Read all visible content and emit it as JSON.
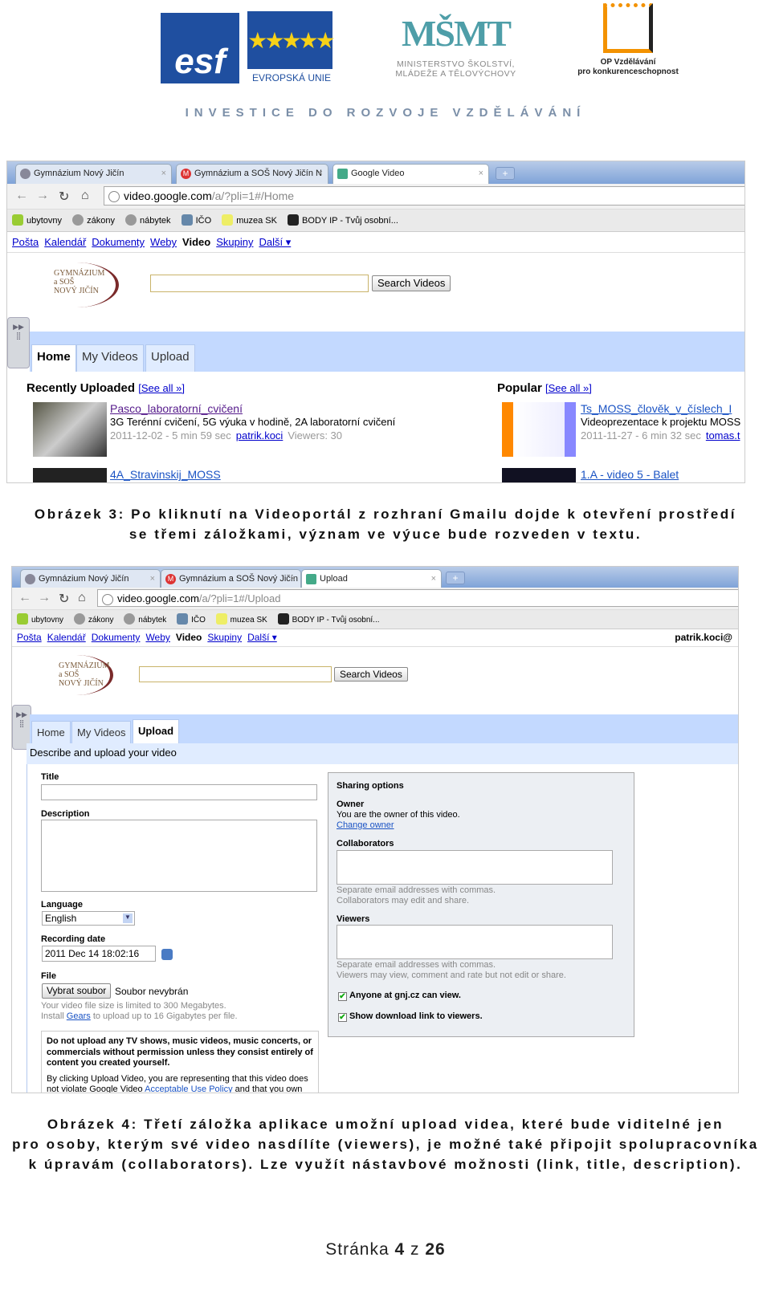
{
  "header": {
    "esf_logo": "esf",
    "eu_label": "EVROPSKÁ UNIE",
    "msmt_logo": "MŠMT",
    "msmt_label_1": "MINISTERSTVO ŠKOLSTVÍ,",
    "msmt_label_2": "MLÁDEŽE A TĚLOVÝCHOVY",
    "op_label_1": "OP Vzdělávání",
    "op_label_2": "pro konkurenceschopnost",
    "tagline": "INVESTICE DO ROZVOJE VZDĚLÁVÁNÍ"
  },
  "browser": {
    "tabs": [
      "Gymnázium Nový Jičín",
      "Gymnázium a SOŠ Nový Jičín N",
      "Google Video"
    ],
    "tabs2": [
      "Gymnázium Nový Jičín",
      "Gymnázium a SOŠ Nový Jičín N",
      "Upload"
    ],
    "url_host": "video.google.com",
    "url_path_home": "/a/?pli=1#/Home",
    "url_path_upload": "/a/?pli=1#/Upload",
    "bookmarks": [
      "ubytovny",
      "zákony",
      "nábytek",
      "IČO",
      "muzea SK",
      "BODY IP - Tvůj osobní..."
    ],
    "gnav": [
      "Pošta",
      "Kalendář",
      "Dokumenty",
      "Weby",
      "Video",
      "Skupiny",
      "Další ▾"
    ],
    "user": "patrik.koci@"
  },
  "video_app": {
    "school_logo_1": "GYMNÁZIUM",
    "school_logo_2": "a SOŠ",
    "school_logo_3": "NOVÝ JIČÍN",
    "search_button": "Search Videos",
    "tabs": [
      "Home",
      "My Videos",
      "Upload"
    ],
    "recent": {
      "heading": "Recently Uploaded",
      "see_all": "[See all »]",
      "items": [
        {
          "title": "Pasco_laboratorní_cvičení",
          "desc": "3G Terénní cvičení, 5G výuka v hodině, 2A laboratorní cvičení",
          "meta": "2011-12-02 - 5 min 59 sec",
          "author": "patrik.koci",
          "viewers": "Viewers: 30"
        },
        {
          "title": "4A_Stravinskij_MOSS"
        }
      ]
    },
    "popular": {
      "heading": "Popular",
      "see_all": "[See all »]",
      "items": [
        {
          "title": "Ts_MOSS_člověk_v_číslech_I",
          "desc": "Videoprezentace k projektu MOSS",
          "meta": "2011-11-27 - 6 min 32 sec",
          "author": "tomas.t"
        },
        {
          "title": "1.A - video 5 - Balet"
        }
      ]
    }
  },
  "upload": {
    "subheader": "Describe and upload your video",
    "title_label": "Title",
    "description_label": "Description",
    "language_label": "Language",
    "language_value": "English",
    "recording_date_label": "Recording date",
    "recording_date_value": "2011 Dec 14 18:02:16",
    "file_label": "File",
    "file_button": "Vybrat soubor",
    "file_status": "Soubor nevybrán",
    "size_note": "Your video file size is limited to 300 Megabytes.",
    "gears_pre": "Install ",
    "gears_link": "Gears",
    "gears_post": " to upload up to 16 Gigabytes per file.",
    "warning_1": "Do not upload any TV shows, music videos, music concerts, or commercials without permission unless they consist entirely of content you created yourself.",
    "warning_2_pre": "By clicking Upload Video, you are representing that this video does not violate Google Video ",
    "warning_2_link": "Acceptable Use Policy",
    "warning_2_post": " and that you own",
    "sharing": {
      "heading": "Sharing options",
      "owner_label": "Owner",
      "owner_text": "You are the owner of this video.",
      "change_owner": "Change owner",
      "collaborators_label": "Collaborators",
      "collab_note_1": "Separate email addresses with commas.",
      "collab_note_2": "Collaborators may edit and share.",
      "viewers_label": "Viewers",
      "viewers_note_1": "Separate email addresses with commas.",
      "viewers_note_2": "Viewers may view, comment and rate but not edit or share.",
      "anyone_checkbox": "Anyone at gnj.cz can view.",
      "anyone_checked": true,
      "download_checkbox": "Show download link to viewers.",
      "download_checked": true
    }
  },
  "captions": {
    "fig3_line1": "Obrázek 3: Po kliknutí na Videoportál z rozhraní Gmailu dojde k otevření prostředí",
    "fig3_line2": "se třemi záložkami, význam ve výuce bude rozveden v textu.",
    "fig4_line1": "Obrázek 4: Třetí záložka aplikace umožní upload videa, které bude viditelné jen",
    "fig4_line2": "pro osoby, kterým své video nasdílíte (viewers), je možné také připojit spolupracovníka",
    "fig4_line3": "k úpravám (collaborators). Lze využít nástavbové možnosti (link, title, description)."
  },
  "footer": {
    "prefix": "Stránka ",
    "page": "4",
    "sep": " z ",
    "total": "26"
  }
}
